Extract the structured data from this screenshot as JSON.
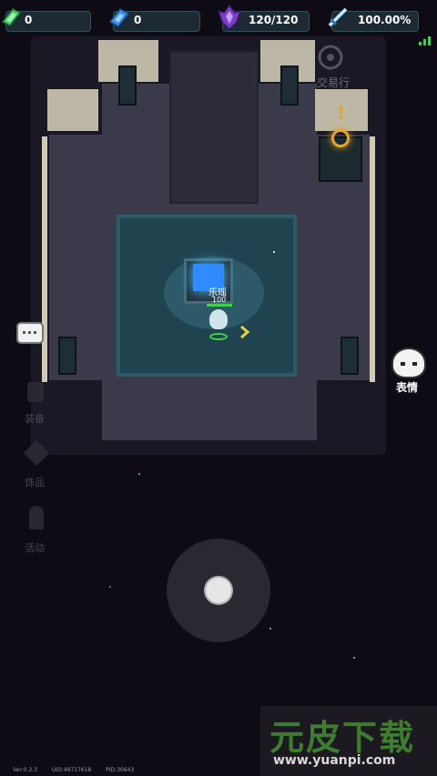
{
  "hud": {
    "green_gems": "0",
    "blue_gems": "0",
    "energy": "120/120",
    "percent": "100.00%"
  },
  "map": {
    "trade_label": "交易行",
    "exclaim": "!",
    "player_name": "乐瑶",
    "player_hp": "100",
    "emote_label": "表情"
  },
  "side_menu": {
    "item1": "装备",
    "item2": "饰品",
    "item3": "活动"
  },
  "footer": {
    "version": "Ver:0.2.3",
    "uid": "UID:49717618",
    "pid": "PID:30643"
  },
  "watermark": {
    "title": "元皮下载",
    "url": "www.yuanpi.com"
  },
  "colors": {
    "accent_green": "#3fd14a",
    "portal_blue": "#2f8bff",
    "gold": "#e3a62a"
  }
}
